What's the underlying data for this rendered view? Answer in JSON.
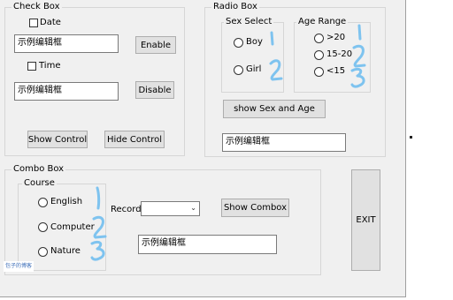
{
  "check_box_group": {
    "title": "Check Box",
    "date_checkbox": "Date",
    "time_checkbox": "Time",
    "textbox1": "示例编辑框",
    "textbox2": "示例编辑框",
    "enable_button": "Enable",
    "disable_button": "Disable",
    "show_control_button": "Show Control",
    "hide_control_button": "Hide Control"
  },
  "radio_box_group": {
    "title": "Radio Box",
    "sex_select": {
      "title": "Sex Select",
      "options": [
        "Boy",
        "Girl"
      ]
    },
    "age_range": {
      "title": "Age Range",
      "options": [
        ">20",
        "15-20",
        "<15"
      ]
    },
    "show_button": "show Sex and Age",
    "textbox": "示例编辑框"
  },
  "combo_box_group": {
    "title": "Combo Box",
    "course": {
      "title": "Course",
      "options": [
        "English",
        "Computer",
        "Nature"
      ]
    },
    "record_label": "Record",
    "record_value": "",
    "show_combox_button": "Show Combox",
    "textbox": "示例编辑框"
  },
  "exit_button": "EXIT",
  "watermark": "包子的博客",
  "colors": {
    "window_bg": "#f0f0f0",
    "annotation": "#7ec3ef"
  }
}
